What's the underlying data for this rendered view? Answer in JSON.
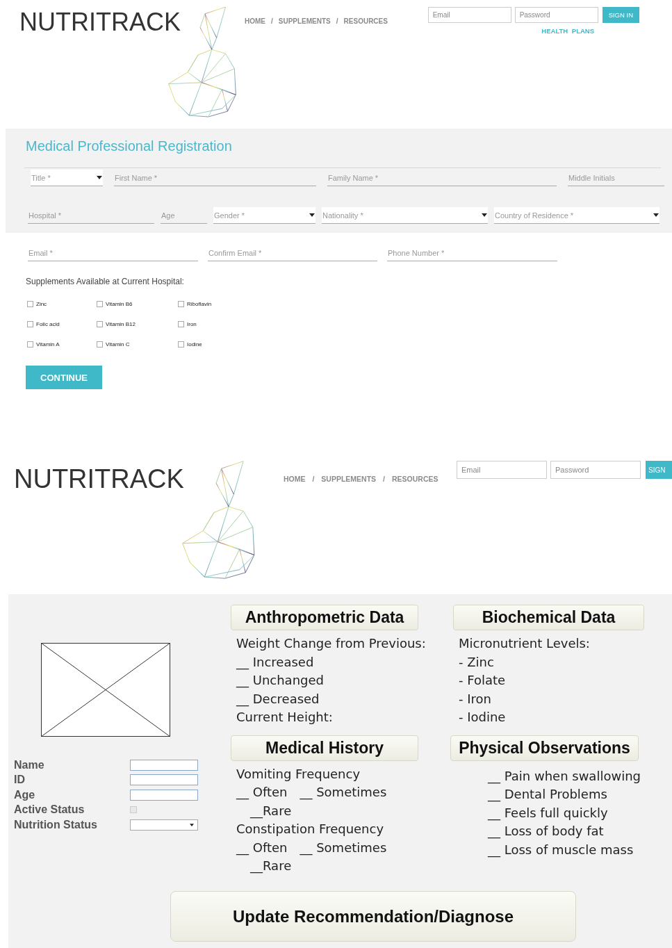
{
  "registration_screen": {
    "header": {
      "logo": "NUTRITRACK",
      "nav": [
        {
          "label": "HOME"
        },
        {
          "separator": "/",
          "label": "SUPPLEMENTS"
        },
        {
          "separator": "/",
          "label": "RESOURCES"
        }
      ],
      "login": {
        "email_placeholder": "Email",
        "password_placeholder": "Password",
        "button": "SIGN IN",
        "link": "HEALTH PLANS"
      }
    },
    "form": {
      "title": "Medical Professional Registration",
      "field_groups": [
        {
          "fields": [
            {
              "kind": "select",
              "placeholder": "Title *"
            },
            {
              "kind": "text",
              "placeholder": "First Name *"
            },
            {
              "kind": "text",
              "placeholder": "Family Name *"
            },
            {
              "kind": "text",
              "placeholder": "Middle Initials"
            }
          ]
        },
        {
          "fields": [
            {
              "kind": "text",
              "placeholder": "Hospital *"
            },
            {
              "kind": "text",
              "placeholder": "Age"
            },
            {
              "kind": "select",
              "placeholder": "Gender *"
            },
            {
              "kind": "select",
              "placeholder": "Nationality *"
            },
            {
              "kind": "select",
              "placeholder": "Country of Residence *"
            }
          ]
        },
        {
          "fields": [
            {
              "kind": "text",
              "placeholder": "Email *"
            },
            {
              "kind": "text",
              "placeholder": "Confirm Email *"
            },
            {
              "kind": "text",
              "placeholder": "Phone Number *"
            }
          ]
        }
      ],
      "supplements_label": "Supplements Available at Current Hospital:",
      "supplements": [
        {
          "label": "Zinc",
          "checked": false
        },
        {
          "label": "Vitamin B6",
          "checked": false
        },
        {
          "label": "Riboflavin",
          "checked": false
        },
        {
          "label": "Folic acid",
          "checked": false
        },
        {
          "label": "Vitamin B12",
          "checked": false
        },
        {
          "label": "Iron",
          "checked": false
        },
        {
          "label": "Vitamin A",
          "checked": false
        },
        {
          "label": "Vitamin C",
          "checked": false
        },
        {
          "label": "Iodine",
          "checked": false
        }
      ],
      "continue_button": "CONTINUE"
    }
  },
  "patient_screen": {
    "header": {
      "logo": "NUTRITRACK",
      "nav": [
        {
          "label": "HOME"
        },
        {
          "separator": "/",
          "label": "SUPPLEMENTS"
        },
        {
          "separator": "/",
          "label": "RESOURCES"
        }
      ],
      "login": {
        "email_placeholder": "Email",
        "password_placeholder": "Password",
        "button": "SIGN"
      }
    },
    "profile_fields": [
      {
        "label": "Name",
        "kind": "text"
      },
      {
        "label": "ID",
        "kind": "text"
      },
      {
        "label": "Age",
        "kind": "text"
      },
      {
        "label": "Active Status",
        "kind": "checkbox",
        "checked": false
      },
      {
        "label": "Nutrition Status",
        "kind": "select"
      }
    ],
    "panels": [
      {
        "heading": "Anthropometric Data",
        "kind": "plain",
        "lines": [
          {
            "kind": "plain",
            "parts": [
              "Weight Change from Previous:"
            ]
          },
          {
            "kind": "plain",
            "parts": [
              "__ Increased"
            ]
          },
          {
            "kind": "plain",
            "parts": [
              "__ Unchanged"
            ]
          },
          {
            "kind": "plain",
            "parts": [
              "__ Decreased"
            ]
          },
          {
            "kind": "plain",
            "parts": [
              "Current Height:"
            ]
          }
        ]
      },
      {
        "heading": "Biochemical Data",
        "kind": "plain",
        "lines": [
          {
            "kind": "plain",
            "parts": [
              "Micronutrient Levels:"
            ]
          },
          {
            "kind": "plain",
            "parts": [
              "- Zinc"
            ]
          },
          {
            "kind": "plain",
            "parts": [
              "- Folate"
            ]
          },
          {
            "kind": "plain",
            "parts": [
              "- Iron"
            ]
          },
          {
            "kind": "plain",
            "parts": [
              "- Iodine"
            ]
          }
        ]
      },
      {
        "heading": "Medical History",
        "kind": "plain",
        "lines": [
          {
            "kind": "plain",
            "parts": [
              "Vomiting Frequency"
            ]
          },
          {
            "kind": "plain",
            "parts": [
              "__ Often",
              "__ Sometimes"
            ]
          },
          {
            "kind": "indented",
            "parts": [
              "__Rare"
            ]
          },
          {
            "kind": "plain",
            "parts": [
              "Constipation Frequency"
            ]
          },
          {
            "kind": "plain",
            "parts": [
              "__ Often",
              "__ Sometimes"
            ]
          },
          {
            "kind": "indented",
            "parts": [
              "__Rare"
            ]
          }
        ]
      },
      {
        "heading": "Physical Observations",
        "kind": "indented",
        "lines": [
          {
            "kind": "plain",
            "parts": [
              "__ Pain when swallowing"
            ]
          },
          {
            "kind": "plain",
            "parts": [
              "__ Dental Problems"
            ]
          },
          {
            "kind": "plain",
            "parts": [
              "__ Feels full quickly"
            ]
          },
          {
            "kind": "plain",
            "parts": [
              "__ Loss of body fat"
            ]
          },
          {
            "kind": "plain",
            "parts": [
              "__ Loss of muscle mass"
            ]
          }
        ]
      }
    ],
    "update_button": "Update Recommendation/Diagnose"
  }
}
